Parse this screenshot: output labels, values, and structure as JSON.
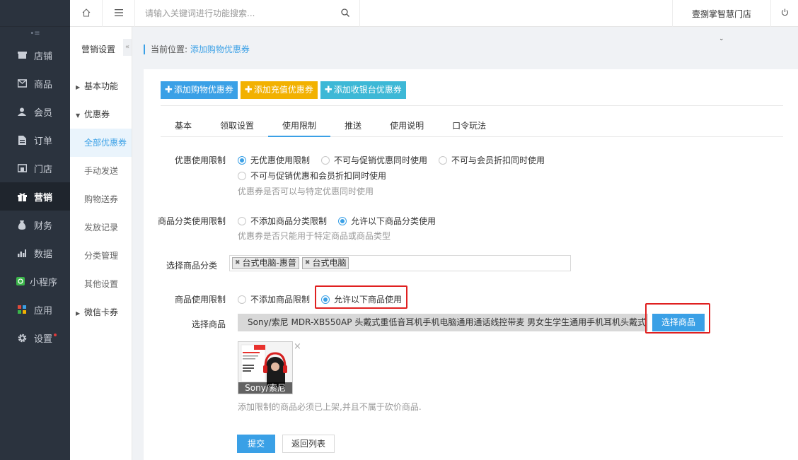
{
  "header": {
    "search_placeholder": "请输入关键词进行功能搜索...",
    "store_name": "壹捌掌智慧门店"
  },
  "sidebar": {
    "items": [
      {
        "label": "店铺",
        "icon": "store-icon"
      },
      {
        "label": "商品",
        "icon": "product-icon"
      },
      {
        "label": "会员",
        "icon": "member-icon"
      },
      {
        "label": "订单",
        "icon": "order-icon"
      },
      {
        "label": "门店",
        "icon": "shop-icon"
      },
      {
        "label": "营销",
        "icon": "gift-icon"
      },
      {
        "label": "财务",
        "icon": "finance-icon"
      },
      {
        "label": "数据",
        "icon": "chart-icon"
      },
      {
        "label": "小程序",
        "icon": "miniapp-icon"
      },
      {
        "label": "应用",
        "icon": "apps-icon"
      },
      {
        "label": "设置",
        "icon": "gear-icon"
      }
    ]
  },
  "subnav": {
    "title": "营销设置",
    "items": [
      "基本功能",
      "优惠券",
      "全部优惠券",
      "手动发送",
      "购物送券",
      "发放记录",
      "分类管理",
      "其他设置",
      "微信卡券"
    ]
  },
  "breadcrumb": {
    "prefix": "当前位置:",
    "current": "添加购物优惠券"
  },
  "toolbar": {
    "add_shopping": "添加购物优惠券",
    "add_recharge": "添加充值优惠券",
    "add_cashier": "添加收银台优惠券"
  },
  "tabs": [
    "基本",
    "领取设置",
    "使用限制",
    "推送",
    "使用说明",
    "口令玩法"
  ],
  "form": {
    "coupon_limit": {
      "label": "优惠使用限制",
      "options": [
        "无优惠使用限制",
        "不可与促销优惠同时使用",
        "不可与会员折扣同时使用",
        "不可与促销优惠和会员折扣同时使用"
      ],
      "hint": "优惠券是否可以与特定优惠同时使用"
    },
    "category_limit": {
      "label": "商品分类使用限制",
      "options": [
        "不添加商品分类限制",
        "允许以下商品分类使用"
      ],
      "hint": "优惠券是否只能用于特定商品或商品类型"
    },
    "select_category": {
      "label": "选择商品分类",
      "tags": [
        "台式电脑-惠普",
        "台式电脑"
      ]
    },
    "product_limit": {
      "label": "商品使用限制",
      "options": [
        "不添加商品限制",
        "允许以下商品使用"
      ]
    },
    "select_product": {
      "label": "选择商品",
      "product_name": "Sony/索尼 MDR-XB550AP 头戴式重低音耳机手机电脑通用通话线控带麦 男女生学生通用手机耳机头戴式",
      "button": "选择商品",
      "thumb_caption": "Sony/索尼",
      "hint": "添加限制的商品必须已上架,并且不属于砍价商品."
    },
    "submit": "提交",
    "back": "返回列表"
  },
  "colors": {
    "accent": "#3aa0e6",
    "sidebar_bg": "#2b333e",
    "highlight_red": "#e02020",
    "yellow": "#f2b100"
  }
}
